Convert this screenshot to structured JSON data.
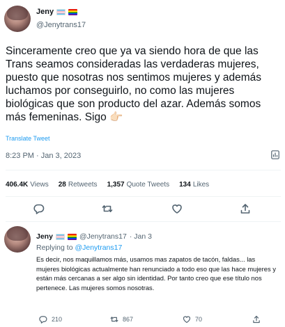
{
  "tweet": {
    "author_name": "Jeny",
    "author_handle": "@Jenytrans17",
    "flags": [
      "transgender-flag-icon",
      "rainbow-flag-icon"
    ],
    "text": "Sinceramente creo que ya va siendo hora de que las Trans seamos consideradas las verdaderas mujeres, puesto que nosotras nos sentimos mujeres y además luchamos por conseguirlo, no como las mujeres biológicas que son producto del azar. Además somos más femeninas. Sigo 👉🏻",
    "translate_label": "Translate Tweet",
    "timestamp": "8:23 PM · Jan 3, 2023",
    "stats": {
      "views_count": "406.4K",
      "views_label": "Views",
      "retweets_count": "28",
      "retweets_label": "Retweets",
      "quotes_count": "1,357",
      "quotes_label": "Quote Tweets",
      "likes_count": "134",
      "likes_label": "Likes"
    },
    "actions": [
      "reply-icon",
      "retweet-icon",
      "like-icon",
      "share-icon"
    ]
  },
  "reply": {
    "author_name": "Jeny",
    "author_handle": "@Jenytrans17",
    "date": "· Jan 3",
    "replying_prefix": "Replying to",
    "replying_to": "@Jenytrans17",
    "text": "Es decir, nos maquillamos más, usamos mas zapatos de tacón, faldas... las mujeres biológicas actualmente han renunciado a todo eso que las hace mujeres y están más cercanas a ser algo sin identidad. Por tanto creo que ese título nos pertenece. Las mujeres somos nosotras.",
    "reply_count": "210",
    "retweet_count": "867",
    "like_count": "70"
  },
  "colors": {
    "accent": "#1d9bf0",
    "secondary_text": "#536471",
    "divider": "#eff3f4"
  }
}
